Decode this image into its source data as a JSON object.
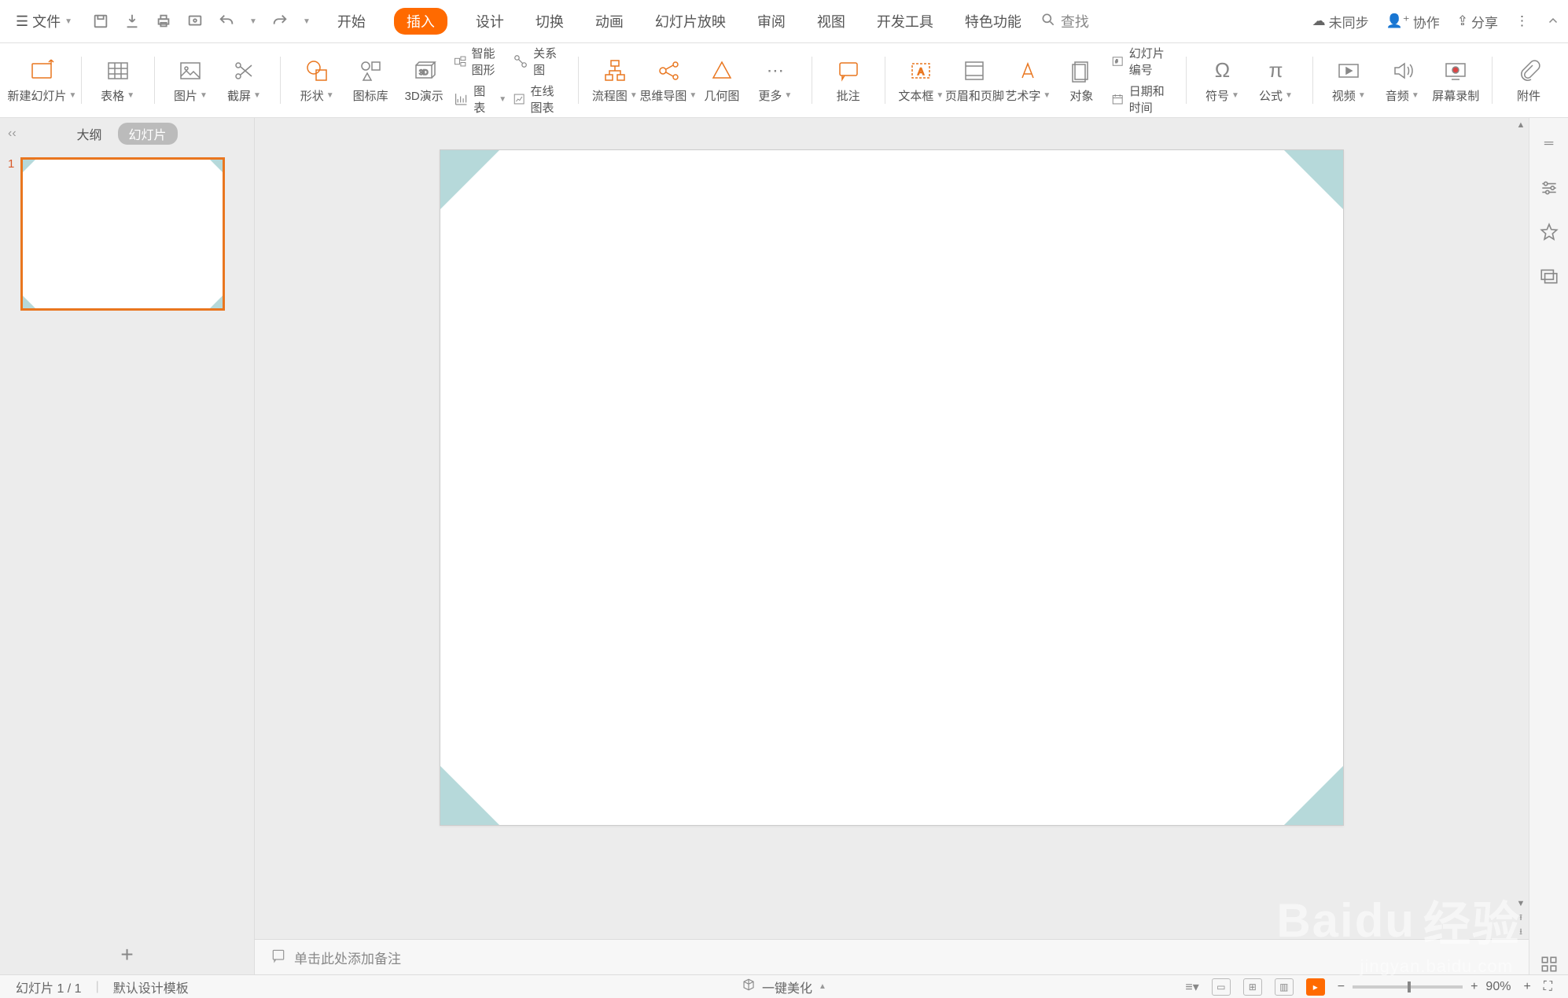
{
  "menu": {
    "file": "文件",
    "tabs": [
      "开始",
      "插入",
      "设计",
      "切换",
      "动画",
      "幻灯片放映",
      "审阅",
      "视图",
      "开发工具",
      "特色功能"
    ],
    "active_tab_index": 1,
    "search": "查找",
    "right": {
      "unsync": "未同步",
      "collab": "协作",
      "share": "分享"
    }
  },
  "ribbon": {
    "new_slide": "新建幻灯片",
    "table": "表格",
    "picture": "图片",
    "screenshot": "截屏",
    "shape": "形状",
    "iconlib": "图标库",
    "p3d": "3D演示",
    "smart": "智能图形",
    "chart": "图表",
    "relation": "关系图",
    "onlinechart": "在线图表",
    "flow": "流程图",
    "mindmap": "思维导图",
    "geom": "几何图",
    "more": "更多",
    "comment": "批注",
    "textbox": "文本框",
    "headerfooter": "页眉和页脚",
    "wordart": "艺术字",
    "object": "对象",
    "slidenum": "幻灯片编号",
    "datetime": "日期和时间",
    "symbol": "符号",
    "formula": "公式",
    "video": "视频",
    "audio": "音频",
    "screencap": "屏幕录制",
    "attach": "附件"
  },
  "side": {
    "outline": "大纲",
    "slides": "幻灯片",
    "thumb_num": "1"
  },
  "notes_placeholder": "单击此处添加备注",
  "status": {
    "page": "幻灯片 1 / 1",
    "template": "默认设计模板",
    "beautify": "一键美化",
    "zoom": "90%"
  },
  "watermark": {
    "brand": "Baidu",
    "label": "经验",
    "url": "jingyan.baidu.com"
  }
}
